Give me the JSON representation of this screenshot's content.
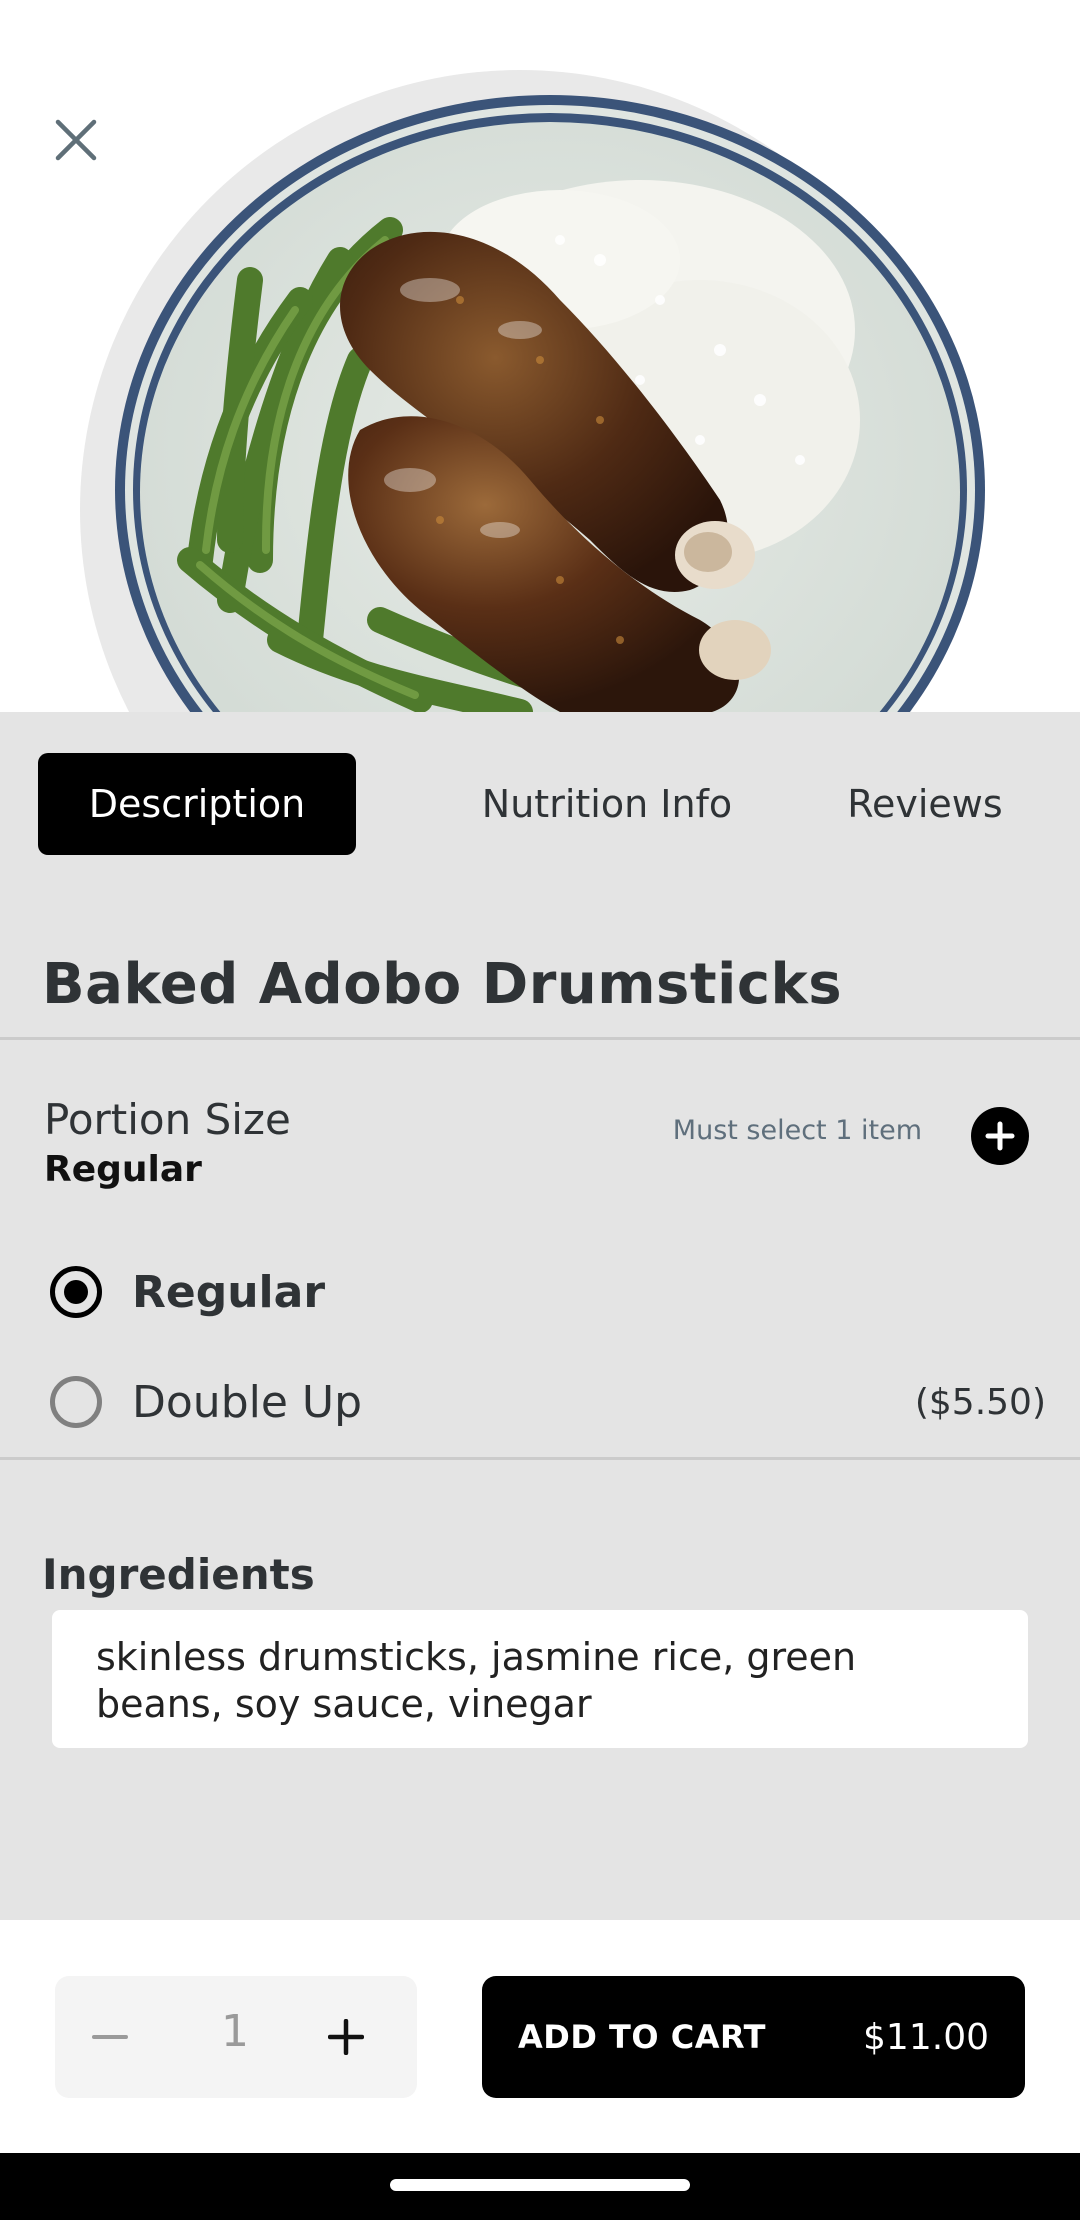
{
  "header": {
    "close_icon": "close-icon",
    "image_alt": "Baked Adobo Drumsticks plate"
  },
  "tabs": [
    {
      "label": "Description",
      "active": true
    },
    {
      "label": "Nutrition Info",
      "active": false
    },
    {
      "label": "Reviews",
      "active": false
    }
  ],
  "product": {
    "title": "Baked Adobo Drumsticks"
  },
  "portion": {
    "label": "Portion Size",
    "selected": "Regular",
    "requirement": "Must select 1 item",
    "add_icon": "plus-circle-icon",
    "options": [
      {
        "label": "Regular",
        "price": "",
        "checked": true
      },
      {
        "label": "Double Up",
        "price": "($5.50)",
        "checked": false
      }
    ]
  },
  "ingredients": {
    "title": "Ingredients",
    "text": "skinless drumsticks, jasmine rice, green beans, soy sauce, vinegar"
  },
  "cart": {
    "quantity": "1",
    "minus_icon": "minus-icon",
    "plus_icon": "plus-icon",
    "button_label": "ADD TO CART",
    "price": "$11.00"
  },
  "colors": {
    "accent": "#000000",
    "content_bg": "#e4e4e4",
    "text": "#2f3336"
  }
}
